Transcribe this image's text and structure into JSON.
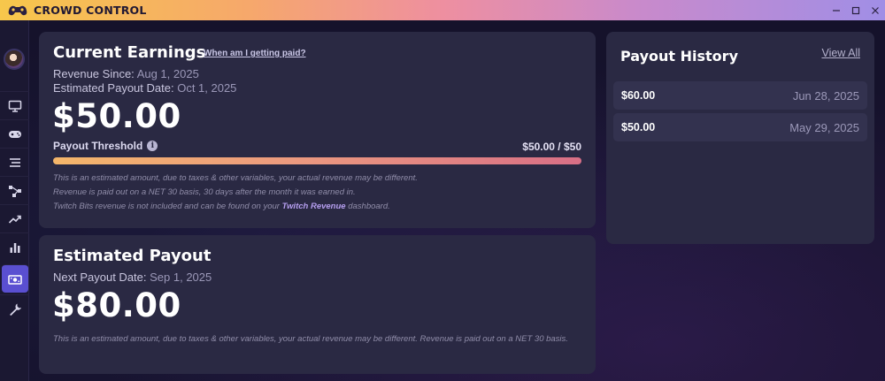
{
  "app": {
    "title": "CROWD CONTROL",
    "controls": {
      "minimize": "—",
      "maximize": "☐",
      "close": "✕"
    }
  },
  "sidebar": {
    "items": [
      {
        "icon": "monitor-icon"
      },
      {
        "icon": "gamepad-icon"
      },
      {
        "icon": "list-icon"
      },
      {
        "icon": "flow-icon"
      },
      {
        "icon": "trending-icon"
      },
      {
        "icon": "bar-chart-icon"
      },
      {
        "icon": "money-icon",
        "active": true
      },
      {
        "icon": "wrench-icon"
      }
    ]
  },
  "current_earnings": {
    "title": "Current Earnings",
    "help_link": "When am I getting paid?",
    "revenue_since_label": "Revenue Since:",
    "revenue_since_value": "Aug 1, 2025",
    "payout_date_label": "Estimated Payout Date:",
    "payout_date_value": "Oct 1, 2025",
    "amount": "$50.00",
    "threshold_label": "Payout Threshold",
    "threshold_value": "$50.00 / $50",
    "threshold_progress": 1.0,
    "note_1": "This is an estimated amount, due to taxes & other variables, your actual revenue may be different.",
    "note_2": "Revenue is paid out on a NET 30 basis, 30 days after the month it was earned in.",
    "note_3_prefix": "Twitch Bits revenue is not included and can be found on your",
    "note_3_link": "Twitch Revenue",
    "note_3_suffix": "dashboard."
  },
  "estimated_payout": {
    "title": "Estimated Payout",
    "next_payout_label": "Next Payout Date:",
    "next_payout_value": "Sep 1, 2025",
    "amount": "$80.00",
    "note": "This is an estimated amount, due to taxes & other variables, your actual revenue may be different. Revenue is paid out on a NET 30 basis."
  },
  "payout_history": {
    "title": "Payout History",
    "view_all": "View All",
    "rows": [
      {
        "amount": "$60.00",
        "date": "Jun 28, 2025"
      },
      {
        "amount": "$50.00",
        "date": "May 29, 2025"
      }
    ]
  },
  "colors": {
    "accent": "#5a4fd1",
    "card": "#2a2943",
    "progress_start": "#f4b66a",
    "progress_end": "#d86f86"
  }
}
